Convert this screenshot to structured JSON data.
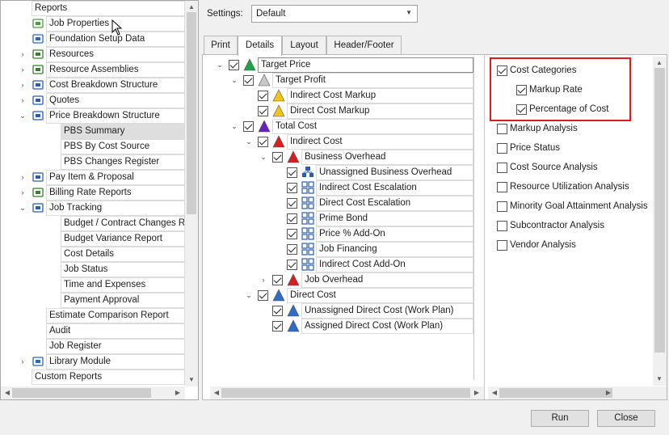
{
  "left_tree": [
    {
      "label": "Reports",
      "indent": 0,
      "expander": "",
      "icon": "none"
    },
    {
      "label": "Job Properties",
      "indent": 1,
      "expander": "",
      "icon": "job-properties-icon"
    },
    {
      "label": "Foundation Setup Data",
      "indent": 1,
      "expander": "",
      "icon": "foundation-setup-icon"
    },
    {
      "label": "Resources",
      "indent": 1,
      "expander": "›",
      "icon": "resources-icon"
    },
    {
      "label": "Resource Assemblies",
      "indent": 1,
      "expander": "›",
      "icon": "resource-assemblies-icon"
    },
    {
      "label": "Cost Breakdown Structure",
      "indent": 1,
      "expander": "›",
      "icon": "cost-breakdown-icon"
    },
    {
      "label": "Quotes",
      "indent": 1,
      "expander": "›",
      "icon": "quotes-icon"
    },
    {
      "label": "Price Breakdown Structure",
      "indent": 1,
      "expander": "⌄",
      "icon": "price-breakdown-icon"
    },
    {
      "label": "PBS Summary",
      "indent": 2,
      "expander": "",
      "icon": "none",
      "selected": true
    },
    {
      "label": "PBS By Cost Source",
      "indent": 2,
      "expander": "",
      "icon": "none"
    },
    {
      "label": "PBS Changes Register",
      "indent": 2,
      "expander": "",
      "icon": "none"
    },
    {
      "label": "Pay Item & Proposal",
      "indent": 1,
      "expander": "›",
      "icon": "pay-item-icon"
    },
    {
      "label": "Billing Rate Reports",
      "indent": 1,
      "expander": "›",
      "icon": "billing-rate-icon"
    },
    {
      "label": "Job Tracking",
      "indent": 1,
      "expander": "⌄",
      "icon": "job-tracking-icon"
    },
    {
      "label": "Budget / Contract Changes Rep",
      "indent": 2,
      "expander": "",
      "icon": "none"
    },
    {
      "label": "Budget Variance Report",
      "indent": 2,
      "expander": "",
      "icon": "none"
    },
    {
      "label": "Cost Details",
      "indent": 2,
      "expander": "",
      "icon": "none"
    },
    {
      "label": "Job Status",
      "indent": 2,
      "expander": "",
      "icon": "none"
    },
    {
      "label": "Time and Expenses",
      "indent": 2,
      "expander": "",
      "icon": "none"
    },
    {
      "label": "Payment Approval",
      "indent": 2,
      "expander": "",
      "icon": "none"
    },
    {
      "label": "Estimate Comparison Report",
      "indent": 1,
      "expander": "",
      "icon": "none"
    },
    {
      "label": "Audit",
      "indent": 1,
      "expander": "",
      "icon": "none"
    },
    {
      "label": "Job Register",
      "indent": 1,
      "expander": "",
      "icon": "none"
    },
    {
      "label": "Library Module",
      "indent": 1,
      "expander": "›",
      "icon": "library-module-icon"
    },
    {
      "label": "Custom Reports",
      "indent": 0,
      "expander": "",
      "icon": "none"
    }
  ],
  "settings": {
    "label": "Settings:",
    "value": "Default"
  },
  "tabs": [
    {
      "label": "Print",
      "active": false
    },
    {
      "label": "Details",
      "active": true
    },
    {
      "label": "Layout",
      "active": false
    },
    {
      "label": "Header/Footer",
      "active": false
    }
  ],
  "detail_tree": [
    {
      "label": "Target Price",
      "level": 0,
      "expander": "⌄",
      "checked": true,
      "icon": "triangle-green-icon",
      "color": "#1fa34a"
    },
    {
      "label": "Target Profit",
      "level": 1,
      "expander": "⌄",
      "checked": true,
      "icon": "triangle-gray-icon",
      "color": "#c8c8c8"
    },
    {
      "label": "Indirect Cost Markup",
      "level": 2,
      "expander": "",
      "checked": true,
      "icon": "triangle-yellow-icon",
      "color": "#f2c318"
    },
    {
      "label": "Direct Cost Markup",
      "level": 2,
      "expander": "",
      "checked": true,
      "icon": "triangle-yellow-icon",
      "color": "#f2c318"
    },
    {
      "label": "Total Cost",
      "level": 1,
      "expander": "⌄",
      "checked": true,
      "icon": "triangle-purple-icon",
      "color": "#6a1fc2"
    },
    {
      "label": "Indirect Cost",
      "level": 2,
      "expander": "⌄",
      "checked": true,
      "icon": "triangle-red-icon",
      "color": "#d62020"
    },
    {
      "label": "Business Overhead",
      "level": 3,
      "expander": "⌄",
      "checked": true,
      "icon": "triangle-red-icon",
      "color": "#d62020"
    },
    {
      "label": "Unassigned Business Overhead",
      "level": 4,
      "expander": "",
      "checked": true,
      "icon": "hierarchy-icon",
      "color": "#2a5db0"
    },
    {
      "label": "Indirect Cost Escalation",
      "level": 4,
      "expander": "",
      "checked": true,
      "icon": "grid-icon",
      "color": "#2a5db0"
    },
    {
      "label": "Direct Cost Escalation",
      "level": 4,
      "expander": "",
      "checked": true,
      "icon": "grid-icon",
      "color": "#2a5db0"
    },
    {
      "label": "Prime Bond",
      "level": 4,
      "expander": "",
      "checked": true,
      "icon": "grid-icon",
      "color": "#2a5db0"
    },
    {
      "label": "Price % Add-On",
      "level": 4,
      "expander": "",
      "checked": true,
      "icon": "grid-icon",
      "color": "#2a5db0"
    },
    {
      "label": "Job Financing",
      "level": 4,
      "expander": "",
      "checked": true,
      "icon": "grid-icon",
      "color": "#2a5db0"
    },
    {
      "label": "Indirect Cost Add-On",
      "level": 4,
      "expander": "",
      "checked": true,
      "icon": "grid-icon",
      "color": "#2a5db0"
    },
    {
      "label": "Job Overhead",
      "level": 3,
      "expander": "›",
      "checked": true,
      "icon": "triangle-red-icon",
      "color": "#d62020"
    },
    {
      "label": "Direct Cost",
      "level": 2,
      "expander": "⌄",
      "checked": true,
      "icon": "triangle-blue-icon",
      "color": "#2f6cc4"
    },
    {
      "label": "Unassigned Direct Cost (Work Plan)",
      "level": 3,
      "expander": "",
      "checked": true,
      "icon": "triangle-blue-icon",
      "color": "#2f6cc4"
    },
    {
      "label": "Assigned Direct Cost (Work Plan)",
      "level": 3,
      "expander": "",
      "checked": true,
      "icon": "triangle-blue-icon",
      "color": "#2f6cc4"
    }
  ],
  "options": [
    {
      "label": "Cost Categories",
      "checked": true,
      "sub": false
    },
    {
      "label": "Markup Rate",
      "checked": true,
      "sub": true
    },
    {
      "label": "Percentage of Cost",
      "checked": true,
      "sub": true
    },
    {
      "label": "Markup Analysis",
      "checked": false,
      "sub": false
    },
    {
      "label": "Price Status",
      "checked": false,
      "sub": false
    },
    {
      "label": "Cost Source Analysis",
      "checked": false,
      "sub": false
    },
    {
      "label": "Resource Utilization Analysis",
      "checked": false,
      "sub": false
    },
    {
      "label": "Minority Goal Attainment Analysis",
      "checked": false,
      "sub": false
    },
    {
      "label": "Subcontractor Analysis",
      "checked": false,
      "sub": false
    },
    {
      "label": "Vendor Analysis",
      "checked": false,
      "sub": false
    }
  ],
  "buttons": {
    "run": "Run",
    "close": "Close"
  },
  "colors": {
    "highlight_box": "#e01a1a",
    "selected_row": "#dedede"
  }
}
